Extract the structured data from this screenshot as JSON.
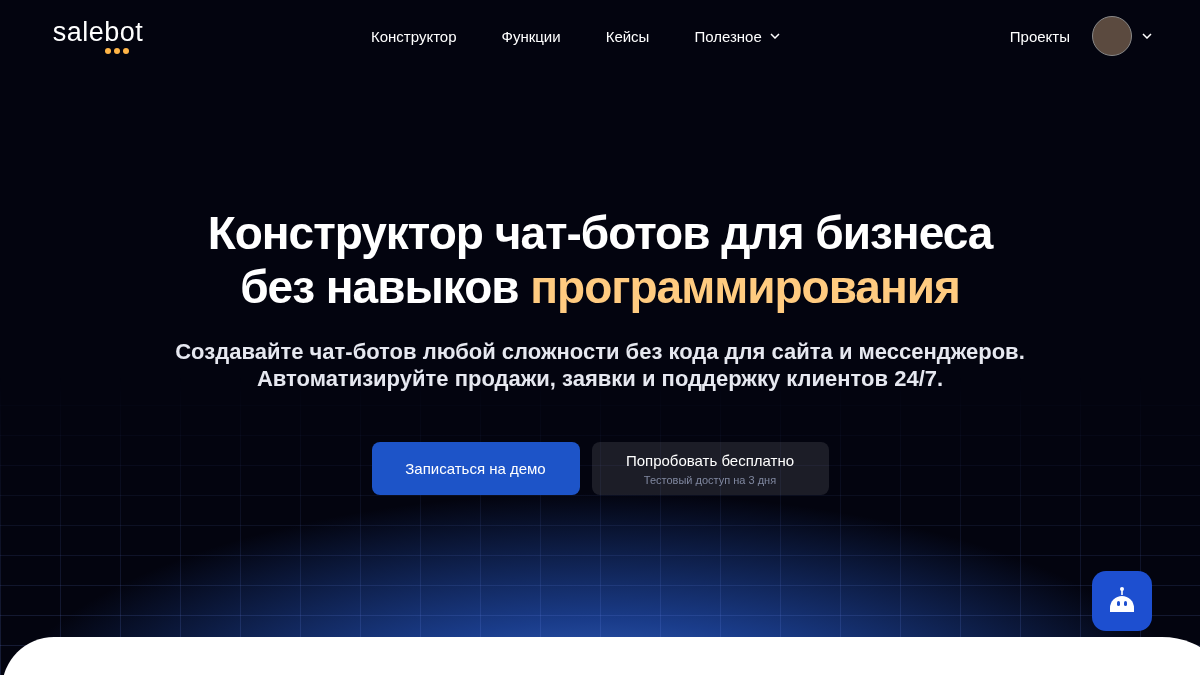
{
  "header": {
    "logo": "salebot",
    "nav": [
      {
        "label": "Конструктор",
        "dropdown": false
      },
      {
        "label": "Функции",
        "dropdown": false
      },
      {
        "label": "Кейсы",
        "dropdown": false
      },
      {
        "label": "Полезное",
        "dropdown": true
      }
    ],
    "projects_link": "Проекты"
  },
  "hero": {
    "title_line1": "Конструктор чат-ботов для бизнеса",
    "title_line2": "без навыков ",
    "title_highlight": "программирования",
    "subtitle": [
      "Создавайте чат-ботов любой сложности без кода для сайта и мессенджеров.",
      "Автоматизируйте продажи, заявки и поддержку клиентов 24/7."
    ],
    "primary_button": "Записаться на демо",
    "secondary_button": {
      "label": "Попробовать бесплатно",
      "note": "Тестовый доступ на 3 дня"
    }
  }
}
